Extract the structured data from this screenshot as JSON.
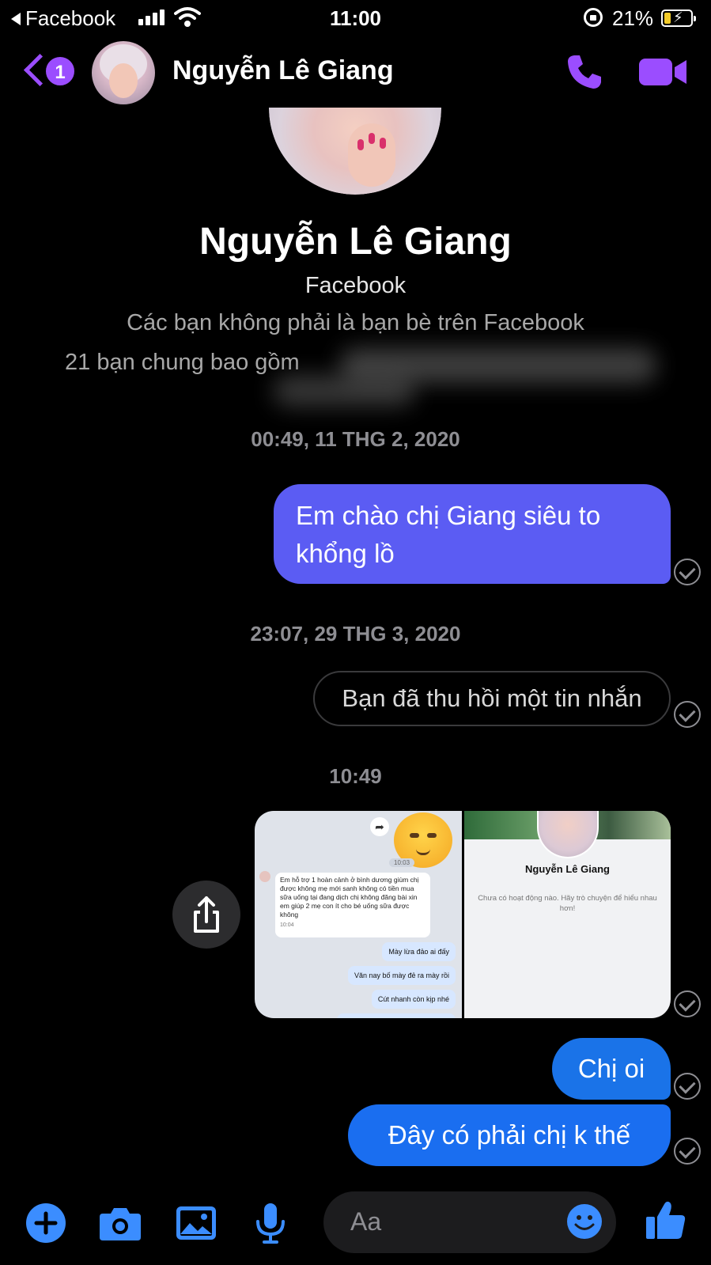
{
  "status_bar": {
    "back_app": "Facebook",
    "time": "11:00",
    "battery_percent": "21%"
  },
  "header": {
    "unread_count": "1",
    "contact_name": "Nguyễn Lê Giang",
    "accent_color": "#9b4dff"
  },
  "profile": {
    "name": "Nguyễn Lê Giang",
    "source": "Facebook",
    "friend_status": "Các bạn không phải là bạn bè trên Facebook",
    "mutual_friends": "21 bạn chung bao gồm"
  },
  "messages": {
    "timestamp_1": "00:49, 11 THG 2, 2020",
    "msg_1": "Em chào chị Giang siêu to khổng lồ",
    "timestamp_2": "23:07, 29 THG 3, 2020",
    "unsent_notice": "Bạn đã thu hồi một tin nhắn",
    "timestamp_3": "10:49",
    "msg_3": "Chị oi",
    "msg_4": "Đây có phải chị k thế"
  },
  "shared_image_left": {
    "time": "10:03",
    "incoming_text": "Em hỗ trợ 1 hoàn cảnh ở bình dương giùm chị được không mẹ mới sanh không có tiền mua sữa uống tại đang dịch chị không đăng bài xin em giúp 2 mẹ con ít cho bé uống sữa được không",
    "incoming_time": "10:04",
    "reply_1": "Mày lừa đảo ai đấy",
    "reply_2": "Văn nay bố mày đẻ ra mày rồi",
    "reply_3": "Cút nhanh còn kịp nhé"
  },
  "shared_image_right": {
    "name": "Nguyễn Lê Giang",
    "text": "Chưa có hoạt động nào. Hãy trò chuyện để hiểu nhau hơn!"
  },
  "composer": {
    "placeholder": "Aa",
    "icons": [
      "plus-icon",
      "camera-icon",
      "gallery-icon",
      "microphone-icon",
      "emoji-icon",
      "like-icon"
    ]
  },
  "colors": {
    "bubble_purple": "#5b5cf3",
    "bubble_blue": "#1a73e8",
    "composer_icon": "#3b8dff"
  }
}
